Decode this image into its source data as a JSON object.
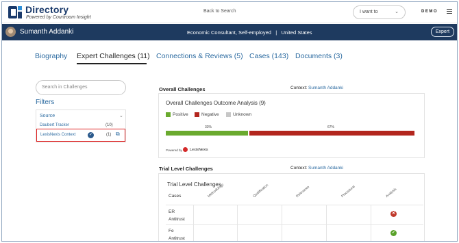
{
  "app": {
    "title": "Directory",
    "subtitle": "Powered by Courtroom Insight",
    "back_link": "Back to Search",
    "i_want_to": "I want to",
    "demo_badge": "DEMO",
    "brand_color": "#1e3a5f"
  },
  "expert": {
    "name": "Sumanth Addanki",
    "title": "Economic Consultant, Self-employed",
    "separator": "|",
    "location": "United States",
    "badge": "Expert"
  },
  "tabs": [
    {
      "label": "Biography",
      "active": false
    },
    {
      "label": "Expert Challenges (11)",
      "active": true
    },
    {
      "label": "Connections & Reviews (5)",
      "active": false
    },
    {
      "label": "Cases (143)",
      "active": false
    },
    {
      "label": "Documents (3)",
      "active": false
    }
  ],
  "sidebar": {
    "search_placeholder": "Search in Challenges",
    "filters_title": "Filters",
    "source_label": "Source",
    "items": [
      {
        "name": "Daubert Tracker",
        "count": "(10)",
        "checked": false
      },
      {
        "name": "LexisNexis Context",
        "count": "(1)",
        "checked": true
      }
    ]
  },
  "overall": {
    "heading": "Overall Challenges",
    "context_label": "Context:",
    "context_name": "Sumanth Addanki",
    "card_title": "Overall Challenges Outcome Analysis (9)",
    "legend": [
      {
        "label": "Positive",
        "color": "#6aaa2e"
      },
      {
        "label": "Negative",
        "color": "#b3261e"
      },
      {
        "label": "Unknown",
        "color": "#c7c7c7"
      }
    ],
    "positive_pct": "33%",
    "negative_pct": "67%",
    "positive_value": 33,
    "negative_value": 67,
    "powered_by": "Powered by",
    "lexis": "LexisNexis"
  },
  "trial": {
    "heading": "Trial Level Challenges",
    "context_label": "Context:",
    "context_name": "Sumanth Addanki",
    "card_title": "Trial Level Challenges",
    "columns": [
      "Cases",
      "Methodology",
      "Qualification",
      "Relevance",
      "Procedural",
      "Analysis"
    ],
    "rows": [
      {
        "case": "ER Antitrust",
        "analysis": "negative"
      },
      {
        "case": "Fe Antitrust",
        "analysis": "positive"
      }
    ]
  }
}
